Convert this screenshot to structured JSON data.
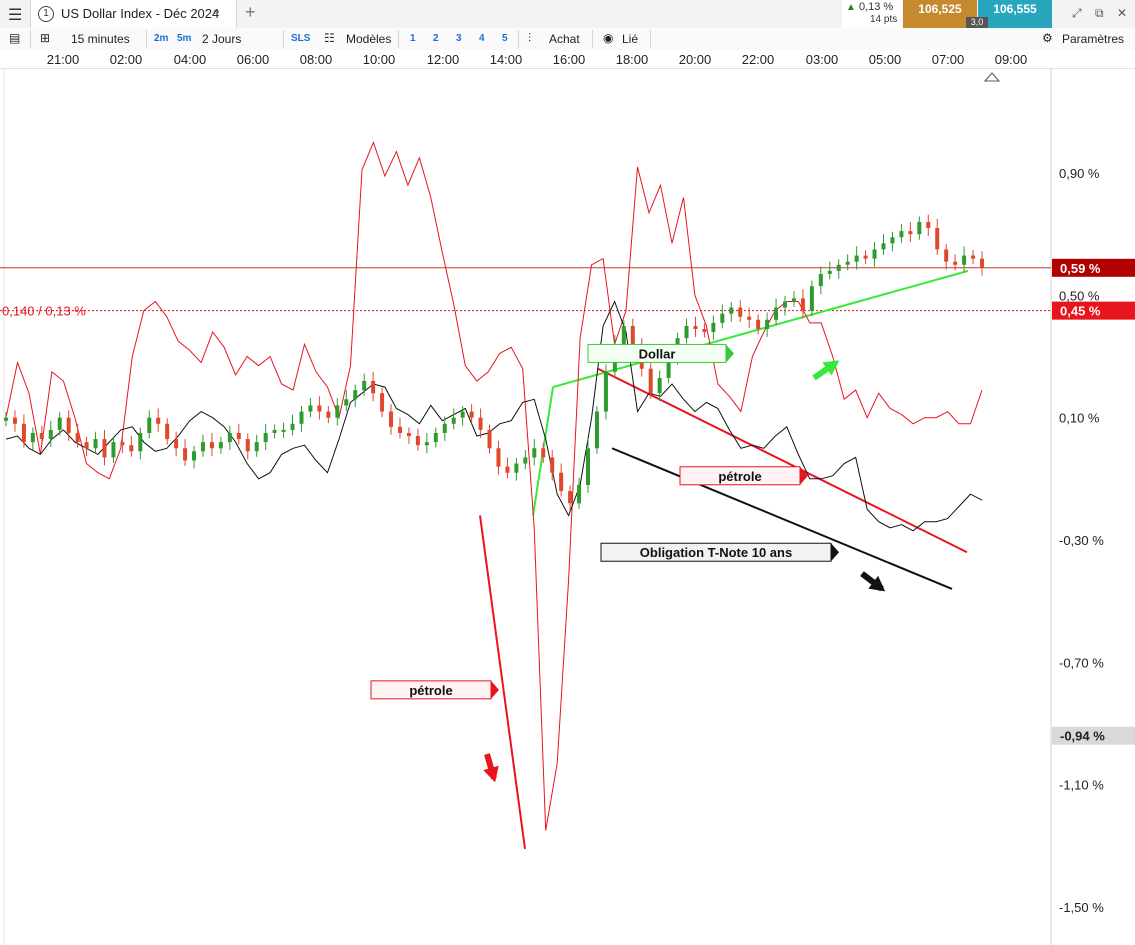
{
  "tabbar": {
    "menu_icon": "hamburger-icon",
    "tab_number": "1",
    "title": "US Dollar Index - Déc 2024",
    "search_icon": "search-icon",
    "add_icon": "plus-icon",
    "change_pct": "0,13 %",
    "change_pts": "14 pts",
    "bid": "106,525",
    "spread": "3,0",
    "ask": "106,555",
    "colors": {
      "bid": "#c58a2e",
      "ask": "#27a6bd",
      "up": "#1a8a1a"
    }
  },
  "toolbar": {
    "timeframe": "15 minutes",
    "tf_2m": "2m",
    "tf_5m": "5m",
    "range": "2 Jours",
    "sls": "SLS",
    "models": "Modèles",
    "layouts": [
      "1",
      "2",
      "3",
      "4",
      "5"
    ],
    "buy": "Achat",
    "linked": "Lié",
    "settings": "Paramètres"
  },
  "time_axis": [
    "21:00",
    "02:00",
    "04:00",
    "06:00",
    "08:00",
    "10:00",
    "12:00",
    "14:00",
    "16:00",
    "18:00",
    "20:00",
    "22:00",
    "03:00",
    "05:00",
    "07:00",
    "09:00"
  ],
  "chart_data": {
    "type": "line",
    "y_unit": "%",
    "y_ticks": [
      "0,90 %",
      "0,50 %",
      "0,10 %",
      "-0,30 %",
      "-0,70 %",
      "-1,10 %",
      "-1,50 %"
    ],
    "ylim": [
      -1.6,
      1.19
    ],
    "price_tags": [
      {
        "label": "0,59 %",
        "value": 0.59,
        "color": "#b00000"
      },
      {
        "label": "0,45 %",
        "value": 0.45,
        "color": "#e8141e"
      },
      {
        "label": "-0,94 %",
        "value": -0.94,
        "color": "#d9d9d9"
      }
    ],
    "ref_line_label": "0,140 / 0,13 %",
    "series": [
      {
        "name": "Dollar",
        "style": "candlestick",
        "colors": {
          "up": "#2e9b2e",
          "down": "#e0482c"
        },
        "values": [
          0.1,
          0.08,
          0.02,
          0.05,
          0.03,
          0.06,
          0.1,
          0.05,
          0.02,
          0.0,
          0.03,
          -0.03,
          0.02,
          0.01,
          -0.01,
          0.05,
          0.1,
          0.08,
          0.03,
          0.0,
          -0.04,
          -0.01,
          0.02,
          0.0,
          0.02,
          0.05,
          0.03,
          -0.01,
          0.02,
          0.05,
          0.06,
          0.06,
          0.08,
          0.12,
          0.14,
          0.12,
          0.1,
          0.14,
          0.16,
          0.19,
          0.22,
          0.18,
          0.12,
          0.07,
          0.05,
          0.04,
          0.01,
          0.02,
          0.05,
          0.08,
          0.1,
          0.12,
          0.1,
          0.06,
          0.0,
          -0.06,
          -0.08,
          -0.05,
          -0.03,
          0.0,
          -0.03,
          -0.08,
          -0.14,
          -0.18,
          -0.12,
          0.0,
          0.12,
          0.25,
          0.34,
          0.4,
          0.33,
          0.26,
          0.18,
          0.23,
          0.3,
          0.36,
          0.4,
          0.39,
          0.38,
          0.41,
          0.44,
          0.46,
          0.43,
          0.42,
          0.39,
          0.42,
          0.46,
          0.48,
          0.49,
          0.45,
          0.53,
          0.57,
          0.58,
          0.6,
          0.61,
          0.63,
          0.62,
          0.65,
          0.67,
          0.69,
          0.71,
          0.7,
          0.74,
          0.72,
          0.65,
          0.61,
          0.6,
          0.63,
          0.62,
          0.59
        ]
      },
      {
        "name": "pétrole",
        "style": "line",
        "color": "#e8141e",
        "values": [
          0.1,
          0.28,
          0.18,
          -0.02,
          0.25,
          0.22,
          0.1,
          -0.05,
          -0.08,
          -0.1,
          0.0,
          0.3,
          0.45,
          0.48,
          0.43,
          0.35,
          0.32,
          0.28,
          0.38,
          0.33,
          0.24,
          0.3,
          0.27,
          0.3,
          0.21,
          0.19,
          0.34,
          0.25,
          0.2,
          0.1,
          0.27,
          0.91,
          1.0,
          0.89,
          0.97,
          0.86,
          0.95,
          0.82,
          0.64,
          0.47,
          0.27,
          0.22,
          0.25,
          0.31,
          0.33,
          0.26,
          -0.26,
          -1.25,
          -1.03,
          -0.43,
          0.36,
          0.6,
          0.62,
          0.34,
          0.45,
          0.92,
          0.77,
          0.86,
          0.67,
          0.82,
          0.5,
          0.4,
          0.21,
          0.17,
          0.12,
          0.3,
          0.38,
          0.45,
          0.48,
          0.48,
          0.41,
          0.41,
          0.3,
          0.16,
          0.19,
          0.1,
          0.18,
          0.13,
          0.11,
          0.08,
          0.1,
          0.1,
          0.12,
          0.08,
          0.08,
          0.19
        ],
        "description": "down-trend labels"
      },
      {
        "name": "Obligation T-Note 10 ans",
        "style": "line",
        "color": "#111111",
        "values": [
          0.03,
          0.04,
          0.0,
          -0.02,
          0.03,
          0.06,
          0.02,
          0.0,
          -0.02,
          0.02,
          0.06,
          0.07,
          0.02,
          -0.01,
          0.0,
          0.04,
          0.09,
          0.12,
          0.1,
          0.07,
          0.02,
          -0.05,
          -0.1,
          -0.08,
          -0.02,
          0.0,
          0.01,
          -0.04,
          -0.08,
          0.03,
          0.15,
          0.18,
          0.21,
          0.2,
          0.13,
          0.11,
          0.08,
          0.14,
          0.09,
          0.11,
          0.13,
          0.04,
          0.05,
          0.08,
          0.09,
          0.15,
          0.16,
          0.03,
          -0.15,
          -0.22,
          -0.12,
          0.1,
          0.4,
          0.48,
          0.38,
          0.12,
          0.18,
          0.17,
          0.21,
          0.16,
          0.12,
          0.15,
          0.13,
          0.06,
          0.0,
          0.01,
          0.0,
          0.04,
          0.07,
          -0.02,
          -0.1,
          -0.1,
          -0.09,
          -0.05,
          -0.03,
          -0.2,
          -0.24,
          -0.26,
          -0.25,
          -0.27,
          -0.24,
          -0.24,
          -0.23,
          -0.19,
          -0.15,
          -0.17
        ]
      }
    ],
    "annotations": [
      {
        "text": "Dollar",
        "border": "#39c83a",
        "fill": "#f2fff2"
      },
      {
        "text": "pétrole",
        "border": "#e8141e",
        "fill": "#fff3f3"
      },
      {
        "text": "pétrole",
        "border": "#e8141e",
        "fill": "#fff3f3"
      },
      {
        "text": "Obligation T-Note 10 ans",
        "border": "#111111",
        "fill": "#f2f2f2"
      }
    ],
    "trend_colors": {
      "dollar": "#39e83a",
      "oil": "#e8141e",
      "bond": "#111111"
    }
  }
}
